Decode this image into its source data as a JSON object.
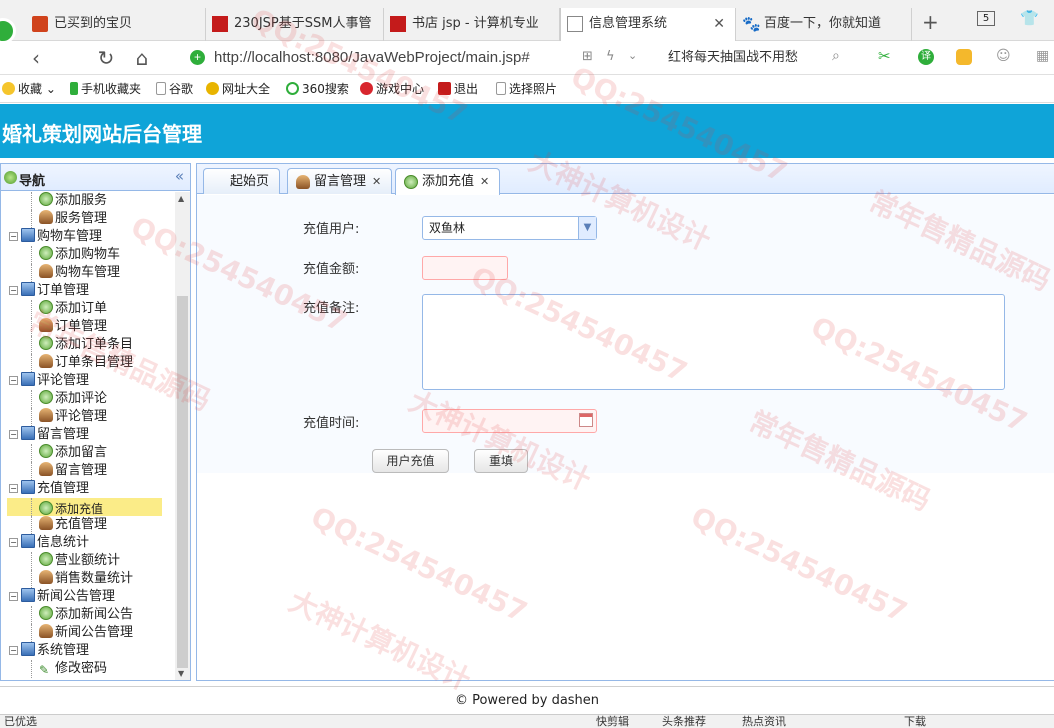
{
  "browser": {
    "tabs": [
      {
        "label": "已买到的宝贝",
        "icon": "taobao-icon"
      },
      {
        "label": "230JSP基于SSM人事管",
        "icon": "page-red-icon"
      },
      {
        "label": "书店 jsp - 计算机专业",
        "icon": "page-red-icon"
      },
      {
        "label": "信息管理系统",
        "icon": "document-icon",
        "active": true
      },
      {
        "label": "百度一下，你就知道",
        "icon": "baidu-paw-icon"
      }
    ],
    "tab_count": "5",
    "url": "http://localhost:8080/JavaWebProject/main.jsp#",
    "news_text": "红将每天抽国战不用愁",
    "bookmarks": [
      "收藏",
      "手机收藏夹",
      "谷歌",
      "网址大全",
      "360搜索",
      "游戏中心",
      "退出",
      "选择照片"
    ]
  },
  "app": {
    "title": "婚礼策划网站后台管理",
    "nav": {
      "title": "导航",
      "items": [
        {
          "type": "add",
          "label": "添加服务"
        },
        {
          "type": "mgr",
          "label": "服务管理"
        },
        {
          "type": "group",
          "label": "购物车管理"
        },
        {
          "type": "add",
          "label": "添加购物车"
        },
        {
          "type": "mgr",
          "label": "购物车管理"
        },
        {
          "type": "group",
          "label": "订单管理"
        },
        {
          "type": "add",
          "label": "添加订单"
        },
        {
          "type": "mgr",
          "label": "订单管理"
        },
        {
          "type": "add",
          "label": "添加订单条目"
        },
        {
          "type": "mgr",
          "label": "订单条目管理"
        },
        {
          "type": "group",
          "label": "评论管理"
        },
        {
          "type": "add",
          "label": "添加评论"
        },
        {
          "type": "mgr",
          "label": "评论管理"
        },
        {
          "type": "group",
          "label": "留言管理"
        },
        {
          "type": "add",
          "label": "添加留言"
        },
        {
          "type": "mgr",
          "label": "留言管理"
        },
        {
          "type": "group",
          "label": "充值管理"
        },
        {
          "type": "add",
          "label": "添加充值",
          "selected": true
        },
        {
          "type": "mgr",
          "label": "充值管理"
        },
        {
          "type": "group",
          "label": "信息统计"
        },
        {
          "type": "add",
          "label": "营业额统计"
        },
        {
          "type": "mgr",
          "label": "销售数量统计"
        },
        {
          "type": "group",
          "label": "新闻公告管理"
        },
        {
          "type": "add",
          "label": "添加新闻公告"
        },
        {
          "type": "mgr",
          "label": "新闻公告管理"
        },
        {
          "type": "group",
          "label": "系统管理"
        },
        {
          "type": "pen",
          "label": "修改密码"
        }
      ]
    },
    "tabs": [
      {
        "label": "起始页",
        "closable": false
      },
      {
        "label": "留言管理",
        "closable": true
      },
      {
        "label": "添加充值",
        "closable": true,
        "active": true
      }
    ],
    "form": {
      "user_label": "充值用户:",
      "user_value": "双鱼林",
      "amount_label": "充值金额:",
      "amount_value": "",
      "memo_label": "充值备注:",
      "memo_value": "",
      "time_label": "充值时间:",
      "time_value": "",
      "submit_label": "用户充值",
      "reset_label": "重填"
    },
    "footer": "© Powered by dashen"
  },
  "statusbar": {
    "left": "已优选",
    "items": [
      "快剪辑",
      "头条推荐",
      "热点资讯",
      "下载"
    ]
  },
  "watermarks": [
    "QQ:254540457",
    "大神计算机设计",
    "常年售精品源码"
  ]
}
